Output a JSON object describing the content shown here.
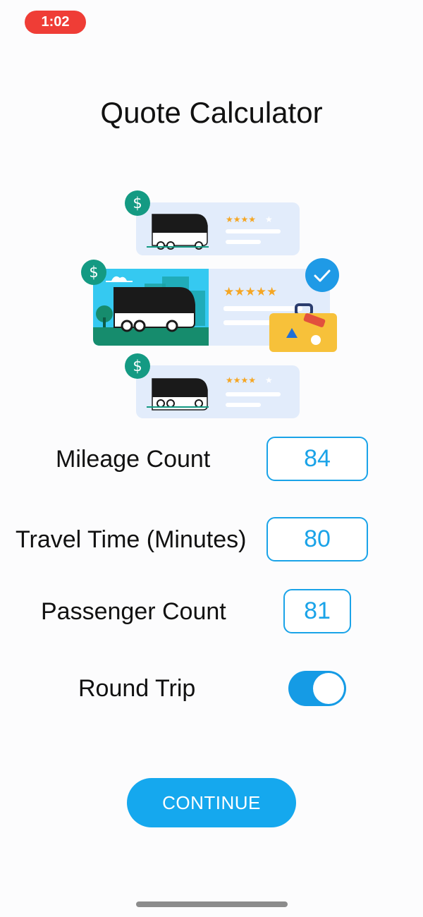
{
  "status_bar": {
    "time": "1:02"
  },
  "header": {
    "title": "Quote Calculator"
  },
  "illustration": {
    "top_card_rating": 4,
    "middle_card_rating": 5,
    "bottom_card_rating": 4,
    "rating_max": 5,
    "colors": {
      "accent_green": "#149a83",
      "check_blue": "#1f9ae6",
      "card_bg": "#e2ecfb",
      "star": "#f5a623",
      "sky": "#35c9f1",
      "suitcase": "#f7c13a"
    }
  },
  "form": {
    "mileage": {
      "label": "Mileage Count",
      "value": "84"
    },
    "travel_time": {
      "label": "Travel Time (Minutes)",
      "value": "80"
    },
    "passengers": {
      "label": "Passenger Count",
      "value": "81"
    },
    "round_trip": {
      "label": "Round Trip",
      "on": true
    }
  },
  "actions": {
    "continue_label": "CONTINUE"
  },
  "theme": {
    "accent": "#15a8ee",
    "time_pill": "#ef3d36"
  }
}
